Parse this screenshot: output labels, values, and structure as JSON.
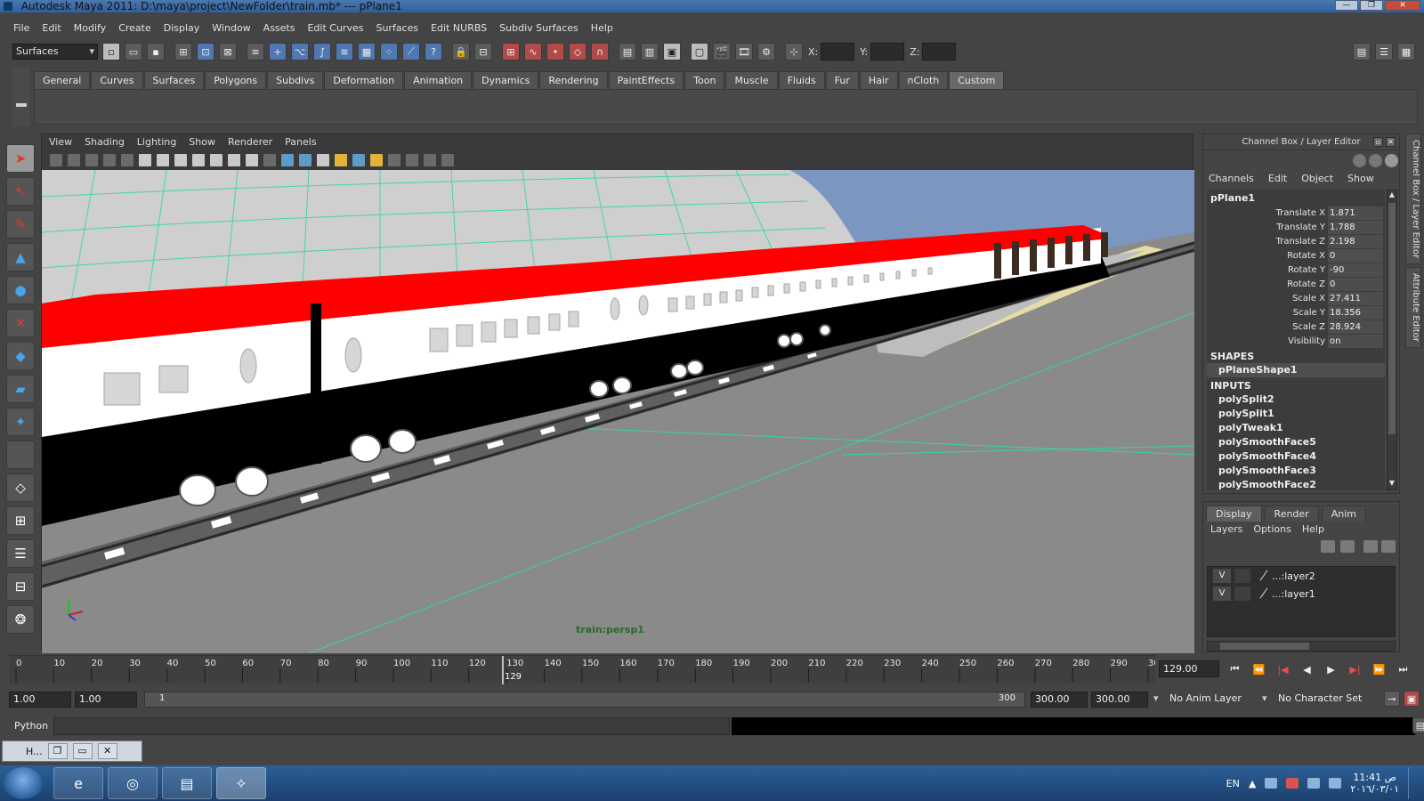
{
  "window": {
    "title": "Autodesk Maya 2011: D:\\maya\\project\\NewFolder\\train.mb*   ---   pPlane1",
    "controls": [
      "—",
      "❐",
      "✕"
    ]
  },
  "menubar": [
    "File",
    "Edit",
    "Modify",
    "Create",
    "Display",
    "Window",
    "Assets",
    "Edit Curves",
    "Surfaces",
    "Edit NURBS",
    "Subdiv Surfaces",
    "Help"
  ],
  "toolbar": {
    "mode": "Surfaces",
    "coord_labels": [
      "X:",
      "Y:",
      "Z:"
    ]
  },
  "shelf": {
    "tabs": [
      "General",
      "Curves",
      "Surfaces",
      "Polygons",
      "Subdivs",
      "Deformation",
      "Animation",
      "Dynamics",
      "Rendering",
      "PaintEffects",
      "Toon",
      "Muscle",
      "Fluids",
      "Fur",
      "Hair",
      "nCloth",
      "Custom"
    ],
    "active_tab": "Custom"
  },
  "viewport": {
    "panel_menu": [
      "View",
      "Shading",
      "Lighting",
      "Show",
      "Renderer",
      "Panels"
    ],
    "camera_label": "train:persp1",
    "colors": {
      "sky": "#7b97c1",
      "ground": "#8a8a8a",
      "grid": "#37d6a0",
      "roof": "#ff0000",
      "body": "#ffffff",
      "underbody": "#000000",
      "platform": "#e6dca6"
    }
  },
  "channel_box": {
    "title": "Channel Box / Layer Editor",
    "menu": [
      "Channels",
      "Edit",
      "Object",
      "Show"
    ],
    "object": "pPlane1",
    "attributes": [
      {
        "name": "Translate X",
        "value": "1.871"
      },
      {
        "name": "Translate Y",
        "value": "1.788"
      },
      {
        "name": "Translate Z",
        "value": "2.198"
      },
      {
        "name": "Rotate X",
        "value": "0"
      },
      {
        "name": "Rotate Y",
        "value": "-90"
      },
      {
        "name": "Rotate Z",
        "value": "0"
      },
      {
        "name": "Scale X",
        "value": "27.411"
      },
      {
        "name": "Scale Y",
        "value": "18.356"
      },
      {
        "name": "Scale Z",
        "value": "28.924"
      },
      {
        "name": "Visibility",
        "value": "on"
      }
    ],
    "shapes_header": "SHAPES",
    "shapes": [
      "pPlaneShape1"
    ],
    "inputs_header": "INPUTS",
    "inputs": [
      "polySplit2",
      "polySplit1",
      "polyTweak1",
      "polySmoothFace5",
      "polySmoothFace4",
      "polySmoothFace3",
      "polySmoothFace2"
    ]
  },
  "side_tabs": [
    "Channel Box / Layer Editor",
    "Attribute Editor"
  ],
  "layer_editor": {
    "tabs": [
      "Display",
      "Render",
      "Anim"
    ],
    "active_tab": "Display",
    "menu": [
      "Layers",
      "Options",
      "Help"
    ],
    "layers": [
      {
        "visible": "V",
        "name": "...:layer2"
      },
      {
        "visible": "V",
        "name": "...:layer1"
      }
    ]
  },
  "time_slider": {
    "ticks": [
      "0",
      "10",
      "20",
      "30",
      "40",
      "50",
      "60",
      "70",
      "80",
      "90",
      "100",
      "110",
      "120",
      "130",
      "140",
      "150",
      "160",
      "170",
      "180",
      "190",
      "200",
      "210",
      "220",
      "230",
      "240",
      "250",
      "260",
      "270",
      "280",
      "290",
      "30"
    ],
    "current_marker": "129",
    "current_frame": "129.00",
    "current_fraction": 0.43
  },
  "playback": [
    "⏮",
    "⏪",
    "|◀",
    "◀",
    "▶",
    "▶|",
    "⏩",
    "⏭"
  ],
  "range_slider": {
    "start_time": "1.00",
    "playback_start": "1.00",
    "range_start": "1",
    "range_end": "300",
    "playback_end": "300.00",
    "end_time": "300.00",
    "anim_layer": "No Anim Layer",
    "character_set": "No Character Set"
  },
  "command_line": {
    "label": "Python"
  },
  "minimized_window": {
    "title": "H..."
  },
  "taskbar": {
    "language": "EN",
    "time": "11:41 ص",
    "date": "٢٠١٦/٠٣/٠١"
  }
}
